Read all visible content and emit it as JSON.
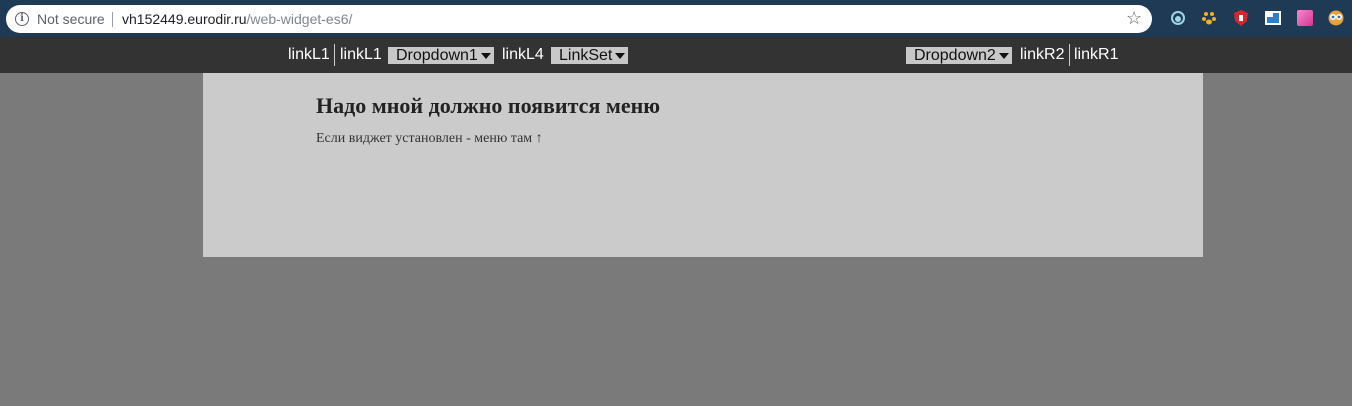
{
  "browser": {
    "security_label": "Not secure",
    "info_icon": "info-icon",
    "url_host": "vh152449.eurodir.ru",
    "url_path": "/web-widget-es6/",
    "bookmark_icon": "star-icon",
    "extensions": [
      "ext-spiral-icon",
      "ext-paw-icon",
      "ext-shield-icon",
      "ext-window-icon",
      "ext-gradient-icon",
      "ext-owl-icon"
    ]
  },
  "navbar": {
    "left": {
      "link1": "linkL1",
      "link2": "linkL1",
      "dropdown1": "Dropdown1",
      "link4": "linkL4",
      "linkset": "LinkSet"
    },
    "right": {
      "dropdown2": "Dropdown2",
      "link_r2": "linkR2",
      "link_r1": "linkR1"
    }
  },
  "content": {
    "title": "Надо мной должно появится меню",
    "text": "Если виджет установлен - меню там ↑"
  },
  "colors": {
    "browser_bar": "#1f3a55",
    "navbar": "#333333",
    "page_bg": "#7a7a7a",
    "content_bg": "#cbcbcb"
  }
}
